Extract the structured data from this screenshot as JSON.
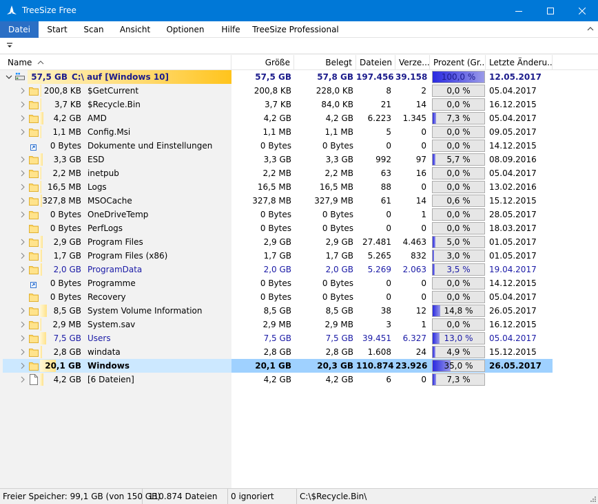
{
  "window": {
    "title": "TreeSize Free"
  },
  "menu": [
    {
      "label": "Datei",
      "active": true
    },
    {
      "label": "Start"
    },
    {
      "label": "Scan"
    },
    {
      "label": "Ansicht"
    },
    {
      "label": "Optionen"
    },
    {
      "label": "Hilfe"
    },
    {
      "label": "TreeSize Professional"
    }
  ],
  "columns": {
    "name": "Name",
    "size": "Größe",
    "allocated": "Belegt",
    "files": "Dateien",
    "folders": "Verze...",
    "percent": "Prozent (Gr...",
    "modified": "Letzte Änderu..."
  },
  "rows": [
    {
      "icon": "drive-icon",
      "expanded": true,
      "root": true,
      "bar": 1.0,
      "tree_size": "57,5 GB",
      "name": "C:\\  auf  [Windows 10]",
      "size": "57,5 GB",
      "allocated": "57,8 GB",
      "files": "197.456",
      "folders": "39.158",
      "percent": "100,0 %",
      "pct": 100,
      "modified": "12.05.2017",
      "style": "root"
    },
    {
      "icon": "folder-icon",
      "bar": 0.02,
      "tree_size": "200,8 KB",
      "name": "$GetCurrent",
      "size": "200,8 KB",
      "allocated": "228,0 KB",
      "files": "8",
      "folders": "2",
      "percent": "0,0 %",
      "pct": 0,
      "modified": "05.04.2017"
    },
    {
      "icon": "folder-icon",
      "bar": 0.02,
      "tree_size": "3,7 KB",
      "name": "$Recycle.Bin",
      "size": "3,7 KB",
      "allocated": "84,0 KB",
      "files": "21",
      "folders": "14",
      "percent": "0,0 %",
      "pct": 0,
      "modified": "16.12.2015"
    },
    {
      "icon": "folder-icon",
      "bar": 0.07,
      "tree_size": "4,2 GB",
      "name": "AMD",
      "size": "4,2 GB",
      "allocated": "4,2 GB",
      "files": "6.223",
      "folders": "1.345",
      "percent": "7,3 %",
      "pct": 7.3,
      "modified": "05.04.2017"
    },
    {
      "icon": "folder-icon",
      "bar": 0.03,
      "tree_size": "1,1 MB",
      "name": "Config.Msi",
      "size": "1,1 MB",
      "allocated": "1,1 MB",
      "files": "5",
      "folders": "0",
      "percent": "0,0 %",
      "pct": 0,
      "modified": "09.05.2017"
    },
    {
      "icon": "link-icon",
      "noexpand": true,
      "bar": 0.0,
      "tree_size": "0 Bytes",
      "name": "Dokumente und Einstellungen",
      "size": "0 Bytes",
      "allocated": "0 Bytes",
      "files": "0",
      "folders": "0",
      "percent": "0,0 %",
      "pct": 0,
      "modified": "14.12.2015"
    },
    {
      "icon": "folder-icon",
      "bar": 0.06,
      "tree_size": "3,3 GB",
      "name": "ESD",
      "size": "3,3 GB",
      "allocated": "3,3 GB",
      "files": "992",
      "folders": "97",
      "percent": "5,7 %",
      "pct": 5.7,
      "modified": "08.09.2016"
    },
    {
      "icon": "folder-icon",
      "bar": 0.03,
      "tree_size": "2,2 MB",
      "name": "inetpub",
      "size": "2,2 MB",
      "allocated": "2,2 MB",
      "files": "63",
      "folders": "16",
      "percent": "0,0 %",
      "pct": 0,
      "modified": "05.04.2017"
    },
    {
      "icon": "folder-icon",
      "bar": 0.03,
      "tree_size": "16,5 MB",
      "name": "Logs",
      "size": "16,5 MB",
      "allocated": "16,5 MB",
      "files": "88",
      "folders": "0",
      "percent": "0,0 %",
      "pct": 0,
      "modified": "13.02.2016"
    },
    {
      "icon": "folder-icon",
      "bar": 0.04,
      "tree_size": "327,8 MB",
      "name": "MSOCache",
      "size": "327,8 MB",
      "allocated": "327,9 MB",
      "files": "61",
      "folders": "14",
      "percent": "0,6 %",
      "pct": 0.6,
      "modified": "15.12.2015"
    },
    {
      "icon": "folder-icon",
      "bar": 0.0,
      "tree_size": "0 Bytes",
      "name": "OneDriveTemp",
      "size": "0 Bytes",
      "allocated": "0 Bytes",
      "files": "0",
      "folders": "1",
      "percent": "0,0 %",
      "pct": 0,
      "modified": "28.05.2017"
    },
    {
      "icon": "folder-icon",
      "noexpand": true,
      "bar": 0.0,
      "tree_size": "0 Bytes",
      "name": "PerfLogs",
      "size": "0 Bytes",
      "allocated": "0 Bytes",
      "files": "0",
      "folders": "0",
      "percent": "0,0 %",
      "pct": 0,
      "modified": "18.03.2017"
    },
    {
      "icon": "folder-icon",
      "bar": 0.06,
      "tree_size": "2,9 GB",
      "name": "Program Files",
      "size": "2,9 GB",
      "allocated": "2,9 GB",
      "files": "27.481",
      "folders": "4.463",
      "percent": "5,0 %",
      "pct": 5.0,
      "modified": "01.05.2017"
    },
    {
      "icon": "folder-icon",
      "bar": 0.05,
      "tree_size": "1,7 GB",
      "name": "Program Files (x86)",
      "size": "1,7 GB",
      "allocated": "1,7 GB",
      "files": "5.265",
      "folders": "832",
      "percent": "3,0 %",
      "pct": 3.0,
      "modified": "01.05.2017"
    },
    {
      "icon": "folder-icon",
      "bar": 0.05,
      "tree_size": "2,0 GB",
      "name": "ProgramData",
      "size": "2,0 GB",
      "allocated": "2,0 GB",
      "files": "5.269",
      "folders": "2.063",
      "percent": "3,5 %",
      "pct": 3.5,
      "modified": "19.04.2017",
      "style": "blue"
    },
    {
      "icon": "link-icon",
      "noexpand": true,
      "bar": 0.0,
      "tree_size": "0 Bytes",
      "name": "Programme",
      "size": "0 Bytes",
      "allocated": "0 Bytes",
      "files": "0",
      "folders": "0",
      "percent": "0,0 %",
      "pct": 0,
      "modified": "14.12.2015"
    },
    {
      "icon": "folder-icon",
      "noexpand": true,
      "bar": 0.0,
      "tree_size": "0 Bytes",
      "name": "Recovery",
      "size": "0 Bytes",
      "allocated": "0 Bytes",
      "files": "0",
      "folders": "0",
      "percent": "0,0 %",
      "pct": 0,
      "modified": "05.04.2017"
    },
    {
      "icon": "folder-icon",
      "bar": 0.15,
      "tree_size": "8,5 GB",
      "name": "System Volume Information",
      "size": "8,5 GB",
      "allocated": "8,5 GB",
      "files": "38",
      "folders": "12",
      "percent": "14,8 %",
      "pct": 14.8,
      "modified": "26.05.2017"
    },
    {
      "icon": "folder-icon",
      "bar": 0.03,
      "tree_size": "2,9 MB",
      "name": "System.sav",
      "size": "2,9 MB",
      "allocated": "2,9 MB",
      "files": "3",
      "folders": "1",
      "percent": "0,0 %",
      "pct": 0,
      "modified": "16.12.2015"
    },
    {
      "icon": "folder-icon",
      "bar": 0.13,
      "tree_size": "7,5 GB",
      "name": "Users",
      "size": "7,5 GB",
      "allocated": "7,5 GB",
      "files": "39.451",
      "folders": "6.327",
      "percent": "13,0 %",
      "pct": 13.0,
      "modified": "05.04.2017",
      "style": "blue"
    },
    {
      "icon": "folder-icon",
      "bar": 0.05,
      "tree_size": "2,8 GB",
      "name": "windata",
      "size": "2,8 GB",
      "allocated": "2,8 GB",
      "files": "1.608",
      "folders": "24",
      "percent": "4,9 %",
      "pct": 4.9,
      "modified": "15.12.2015"
    },
    {
      "icon": "folder-icon",
      "bar": 0.35,
      "tree_size": "20,1 GB",
      "name": "Windows",
      "size": "20,1 GB",
      "allocated": "20,3 GB",
      "files": "110.874",
      "folders": "23.926",
      "percent": "35,0 %",
      "pct": 35.0,
      "modified": "26.05.2017",
      "style": "selected"
    },
    {
      "icon": "file-icon",
      "bar": 0.07,
      "tree_size": "4,2 GB",
      "name": "[6 Dateien]",
      "size": "4,2 GB",
      "allocated": "4,2 GB",
      "files": "6",
      "folders": "0",
      "percent": "7,3 %",
      "pct": 7.3,
      "modified": ""
    }
  ],
  "status": {
    "free": "Freier Speicher: 99,1 GB  (von 150 GB)",
    "files": "110.874  Dateien",
    "ignored": "0 ignoriert",
    "path": "C:\\$Recycle.Bin\\"
  }
}
